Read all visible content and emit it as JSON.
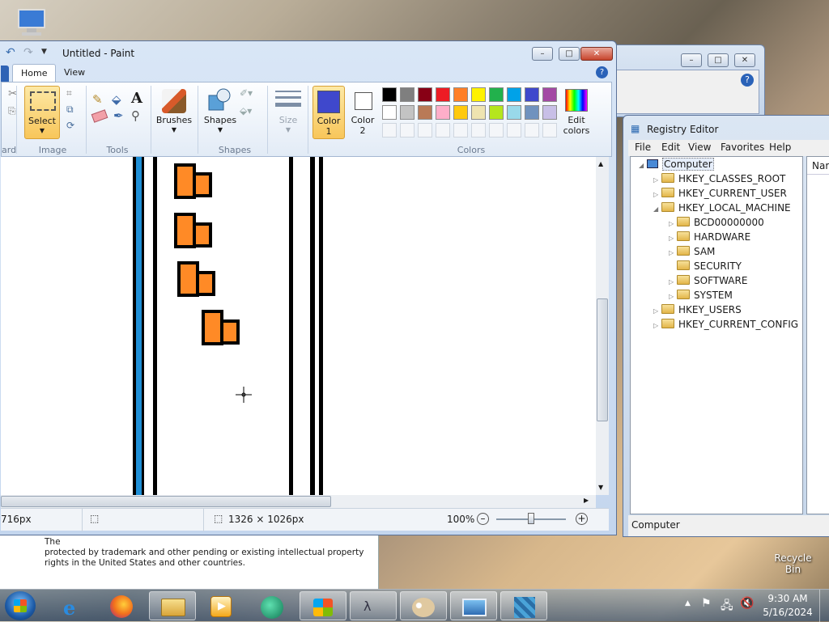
{
  "desktop": {
    "recycle_bin_label": "Recycle Bin"
  },
  "about_dialog": {
    "line1": "The",
    "line2": "protected by trademark and other pending or existing intellectual property",
    "line3": "rights in the United States and other countries."
  },
  "paint": {
    "title": "Untitled - Paint",
    "tabs": [
      "Home",
      "View"
    ],
    "groups": {
      "clipboard_partial": "ard",
      "image": "Image",
      "tools": "Tools",
      "shapes": "Shapes",
      "colors": "Colors"
    },
    "buttons": {
      "select": "Select",
      "brushes": "Brushes",
      "shapes": "Shapes",
      "size": "Size",
      "color1_line1": "Color",
      "color1_line2": "1",
      "color2_line1": "Color",
      "color2_line2": "2",
      "edit_colors_line1": "Edit",
      "edit_colors_line2": "colors"
    },
    "colors": {
      "color1": "#3f48cc",
      "color2": "#ffffff",
      "palette_row1": [
        "#000000",
        "#7f7f7f",
        "#880015",
        "#ed1c24",
        "#ff7f27",
        "#fff200",
        "#22b14c",
        "#00a2e8",
        "#3f48cc",
        "#a349a4"
      ],
      "palette_row2": [
        "#ffffff",
        "#c3c3c3",
        "#b97a57",
        "#ffaec9",
        "#ffc90e",
        "#efe4b0",
        "#b5e61d",
        "#99d9ea",
        "#7092be",
        "#c8bfe7"
      ]
    },
    "status": {
      "cursor_pos_partial": "716px",
      "image_size": "1326 × 1026px",
      "zoom": "100%"
    }
  },
  "registry": {
    "title": "Registry Editor",
    "menu": [
      "File",
      "Edit",
      "View",
      "Favorites",
      "Help"
    ],
    "right_header_partial": "Nar",
    "tree": [
      {
        "label": "Computer",
        "level": 0
      },
      {
        "label": "HKEY_CLASSES_ROOT",
        "level": 1
      },
      {
        "label": "HKEY_CURRENT_USER",
        "level": 1
      },
      {
        "label": "HKEY_LOCAL_MACHINE",
        "level": 1
      },
      {
        "label": "BCD00000000",
        "level": 2
      },
      {
        "label": "HARDWARE",
        "level": 2
      },
      {
        "label": "SAM",
        "level": 2
      },
      {
        "label": "SECURITY",
        "level": 2
      },
      {
        "label": "SOFTWARE",
        "level": 2
      },
      {
        "label": "SYSTEM",
        "level": 2
      },
      {
        "label": "HKEY_USERS",
        "level": 1
      },
      {
        "label": "HKEY_CURRENT_CONFIG",
        "level": 1
      }
    ],
    "status": "Computer"
  },
  "taskbar": {
    "time": "9:30 AM",
    "date": "5/16/2024"
  }
}
